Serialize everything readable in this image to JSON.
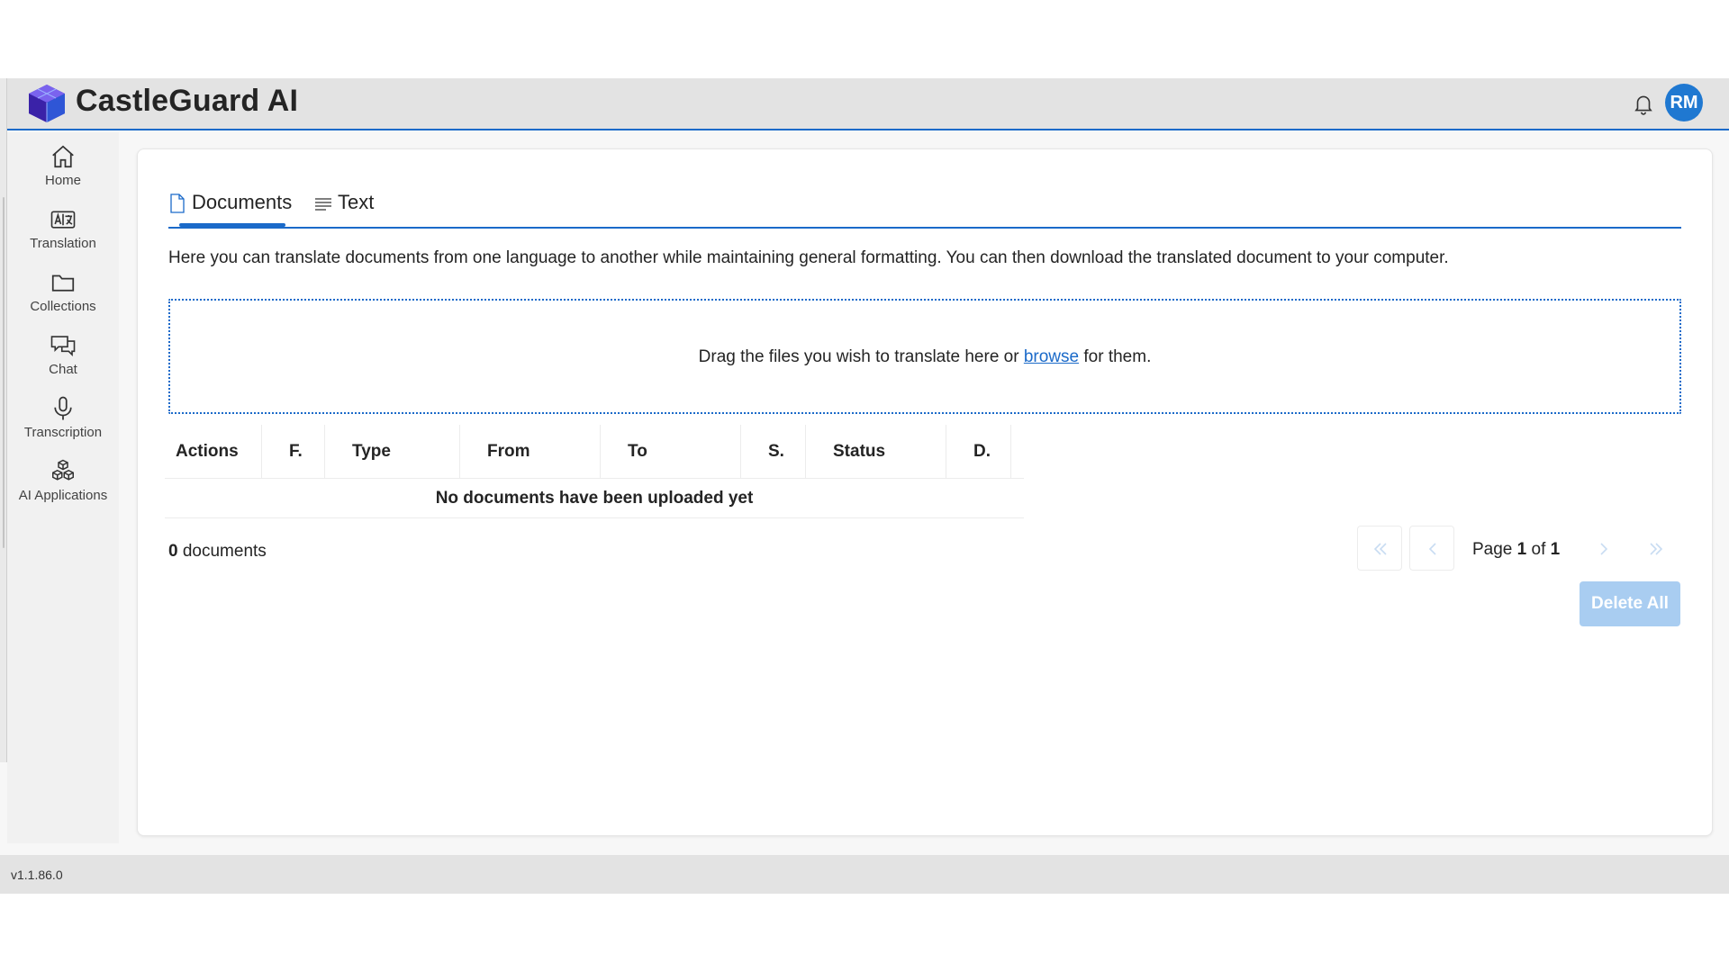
{
  "app": {
    "title": "CastleGuard AI",
    "user_initials": "RM",
    "version": "v1.1.86.0"
  },
  "colors": {
    "accent": "#1b6ac9",
    "avatar": "#1f78d1",
    "delete_button_disabled": "#a9cdf1",
    "logo": "#5b3fd6"
  },
  "nav": {
    "items": [
      {
        "label": "Home",
        "icon": "home-icon"
      },
      {
        "label": "Translation",
        "icon": "translation-icon"
      },
      {
        "label": "Collections",
        "icon": "folder-icon"
      },
      {
        "label": "Chat",
        "icon": "chat-icon"
      },
      {
        "label": "Transcription",
        "icon": "microphone-icon"
      },
      {
        "label": "AI Applications",
        "icon": "cubes-icon"
      }
    ]
  },
  "tabs": [
    {
      "label": "Documents",
      "icon": "document-icon",
      "selected": true
    },
    {
      "label": "Text",
      "icon": "text-lines-icon",
      "selected": false
    }
  ],
  "description": "Here you can translate documents from one language to another while maintaining general formatting. You can then download the translated document to your computer.",
  "dropzone": {
    "prefix": "Drag the files you wish to translate here or ",
    "link": "browse",
    "suffix": " for them."
  },
  "table": {
    "columns": [
      "Actions",
      "F.",
      "Type",
      "From",
      "To",
      "S.",
      "Status",
      "D."
    ],
    "empty_message": "No documents have been uploaded yet"
  },
  "doc_count": {
    "count": "0",
    "label": " documents"
  },
  "pagination": {
    "prefix": "Page ",
    "current": "1",
    "middle": " of ",
    "total": "1"
  },
  "delete_all_label": "Delete All"
}
